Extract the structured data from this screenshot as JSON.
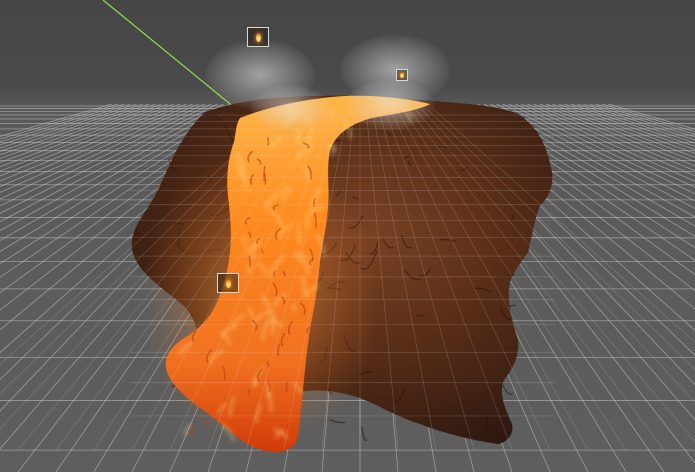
{
  "scene": {
    "background_color": "#474747",
    "grid_color": "#d0d0d0",
    "axis_line_color": "#8ee04a",
    "terrain_colors": [
      "#2a160e",
      "#5a2e18",
      "#8a4a26"
    ],
    "lava_colors": [
      "#ffd870",
      "#ff8a1e",
      "#d23a08"
    ]
  },
  "gizmos": [
    {
      "name": "point-light-top",
      "icon": "light-icon"
    },
    {
      "name": "point-light-right",
      "icon": "light-icon"
    },
    {
      "name": "point-light-lava",
      "icon": "light-icon"
    }
  ]
}
